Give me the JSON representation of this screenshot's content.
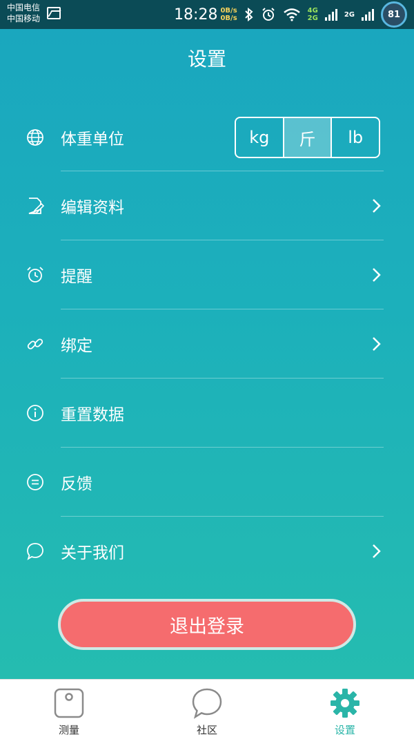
{
  "status_bar": {
    "carrier1": "中国电信",
    "carrier2": "中国移动",
    "time": "18:28",
    "speed_up": "0B/s",
    "speed_down": "0B/s",
    "net_a": "4G",
    "net_b": "2G",
    "net_c": "2G",
    "battery": "81"
  },
  "header": {
    "title": "设置"
  },
  "settings": {
    "weight_unit": {
      "label": "体重单位",
      "options": [
        "kg",
        "斤",
        "lb"
      ],
      "selected": "斤"
    },
    "items": [
      {
        "label": "编辑资料",
        "icon": "edit-profile-icon",
        "has_chevron": true
      },
      {
        "label": "提醒",
        "icon": "alarm-clock-icon",
        "has_chevron": true
      },
      {
        "label": "绑定",
        "icon": "link-icon",
        "has_chevron": true
      },
      {
        "label": "重置数据",
        "icon": "info-icon",
        "has_chevron": false
      },
      {
        "label": "反馈",
        "icon": "feedback-icon",
        "has_chevron": false
      },
      {
        "label": "关于我们",
        "icon": "chat-bubble-icon",
        "has_chevron": true
      }
    ]
  },
  "logout": {
    "label": "退出登录"
  },
  "tabbar": {
    "tabs": [
      {
        "label": "测量",
        "icon": "scale-icon"
      },
      {
        "label": "社区",
        "icon": "chat-bubble-icon"
      },
      {
        "label": "设置",
        "icon": "gear-icon",
        "active": true
      }
    ]
  },
  "colors": {
    "accent": "#2ab5a8",
    "logout": "#f56c6e",
    "background_top": "#1aa6bf",
    "background_bottom": "#25bcb0"
  }
}
